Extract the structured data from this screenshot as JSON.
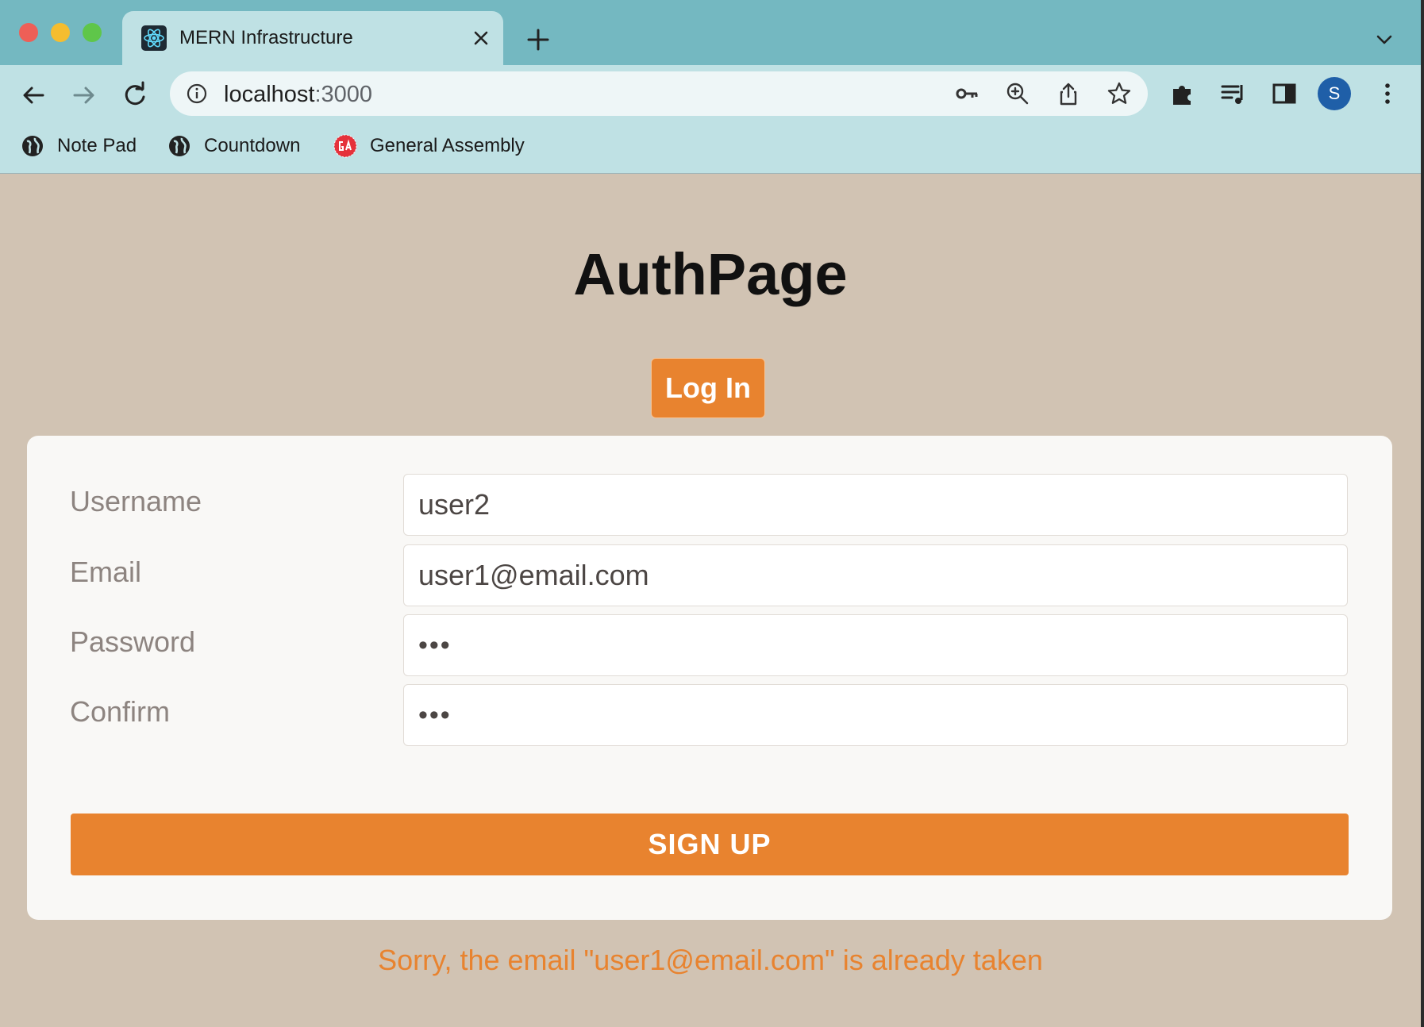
{
  "browser": {
    "tab": {
      "title": "MERN Infrastructure",
      "favicon": "react-logo-icon"
    },
    "address_bar": {
      "host": "localhost",
      "port": ":3000"
    },
    "profile_initial": "S",
    "bookmarks": [
      {
        "label": "Note Pad",
        "icon": "globe-icon"
      },
      {
        "label": "Countdown",
        "icon": "globe-icon"
      },
      {
        "label": "General Assembly",
        "icon": "ga-logo-icon"
      }
    ]
  },
  "page": {
    "title": "AuthPage",
    "login_button": "Log In",
    "form": {
      "username": {
        "label": "Username",
        "value": "user2"
      },
      "email": {
        "label": "Email",
        "value": "user1@email.com"
      },
      "password": {
        "label": "Password",
        "value": "•••"
      },
      "confirm": {
        "label": "Confirm",
        "value": "•••"
      },
      "submit": "SIGN UP"
    },
    "error": "Sorry, the email \"user1@email.com\" is already taken"
  },
  "colors": {
    "accent": "#e8832f",
    "page_background": "#d1c3b3",
    "browser_frame": "#74b8c1",
    "toolbar": "#bfe1e4",
    "card": "#f9f8f6"
  }
}
